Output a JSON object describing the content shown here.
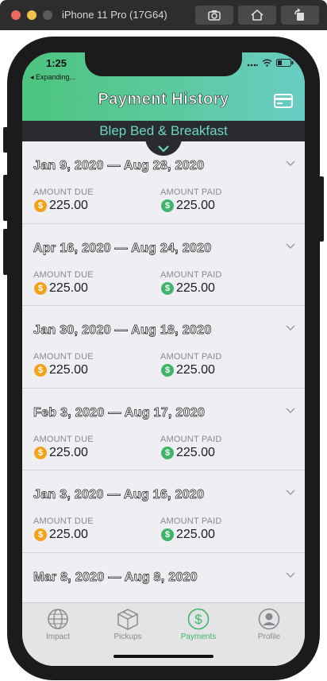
{
  "simulator": {
    "title": "iPhone 11 Pro (17G64)"
  },
  "status_bar": {
    "time": "1:25",
    "back_app": "◂ Expanding..."
  },
  "header": {
    "title": "Payment History",
    "subtitle": "Blep Bed & Breakfast"
  },
  "labels": {
    "amount_due": "AMOUNT DUE",
    "amount_paid": "AMOUNT PAID"
  },
  "payments": [
    {
      "range": "Jan 9, 2020 — Aug 28, 2020",
      "due": "225.00",
      "paid": "225.00"
    },
    {
      "range": "Apr 16, 2020 — Aug 24, 2020",
      "due": "225.00",
      "paid": "225.00"
    },
    {
      "range": "Jan 30, 2020 — Aug 18, 2020",
      "due": "225.00",
      "paid": "225.00"
    },
    {
      "range": "Feb 3, 2020 — Aug 17, 2020",
      "due": "225.00",
      "paid": "225.00"
    },
    {
      "range": "Jan 3, 2020 — Aug 16, 2020",
      "due": "225.00",
      "paid": "225.00"
    },
    {
      "range": "Mar 8, 2020 — Aug 8, 2020",
      "due": "",
      "paid": ""
    }
  ],
  "tabs": [
    {
      "label": "Impact",
      "icon": "globe-icon"
    },
    {
      "label": "Pickups",
      "icon": "box-icon"
    },
    {
      "label": "Payments",
      "icon": "dollar-icon",
      "active": true
    },
    {
      "label": "Profile",
      "icon": "profile-icon"
    }
  ],
  "colors": {
    "accent": "#3fb56a",
    "header_dark": "#2a2b2e",
    "coin_due": "#f5a21b",
    "subtitle": "#69d6c5"
  }
}
